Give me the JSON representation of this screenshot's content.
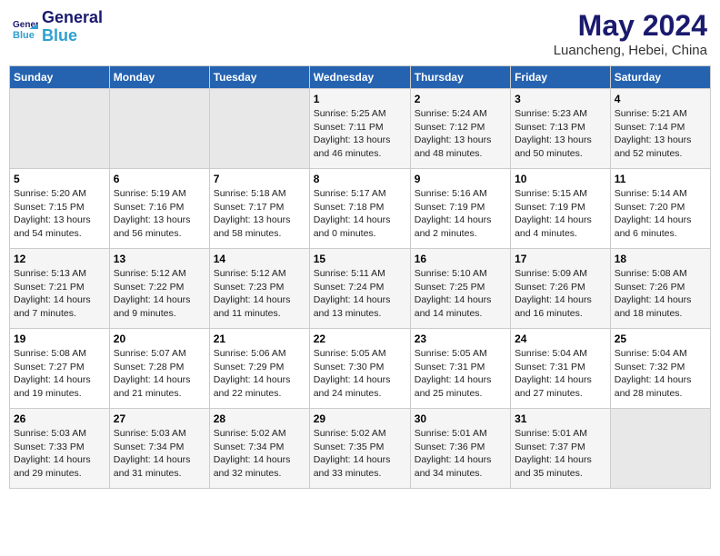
{
  "header": {
    "logo_line1": "General",
    "logo_line2": "Blue",
    "month_year": "May 2024",
    "location": "Luancheng, Hebei, China"
  },
  "weekdays": [
    "Sunday",
    "Monday",
    "Tuesday",
    "Wednesday",
    "Thursday",
    "Friday",
    "Saturday"
  ],
  "weeks": [
    [
      {
        "day": "",
        "info": ""
      },
      {
        "day": "",
        "info": ""
      },
      {
        "day": "",
        "info": ""
      },
      {
        "day": "1",
        "info": "Sunrise: 5:25 AM\nSunset: 7:11 PM\nDaylight: 13 hours\nand 46 minutes."
      },
      {
        "day": "2",
        "info": "Sunrise: 5:24 AM\nSunset: 7:12 PM\nDaylight: 13 hours\nand 48 minutes."
      },
      {
        "day": "3",
        "info": "Sunrise: 5:23 AM\nSunset: 7:13 PM\nDaylight: 13 hours\nand 50 minutes."
      },
      {
        "day": "4",
        "info": "Sunrise: 5:21 AM\nSunset: 7:14 PM\nDaylight: 13 hours\nand 52 minutes."
      }
    ],
    [
      {
        "day": "5",
        "info": "Sunrise: 5:20 AM\nSunset: 7:15 PM\nDaylight: 13 hours\nand 54 minutes."
      },
      {
        "day": "6",
        "info": "Sunrise: 5:19 AM\nSunset: 7:16 PM\nDaylight: 13 hours\nand 56 minutes."
      },
      {
        "day": "7",
        "info": "Sunrise: 5:18 AM\nSunset: 7:17 PM\nDaylight: 13 hours\nand 58 minutes."
      },
      {
        "day": "8",
        "info": "Sunrise: 5:17 AM\nSunset: 7:18 PM\nDaylight: 14 hours\nand 0 minutes."
      },
      {
        "day": "9",
        "info": "Sunrise: 5:16 AM\nSunset: 7:19 PM\nDaylight: 14 hours\nand 2 minutes."
      },
      {
        "day": "10",
        "info": "Sunrise: 5:15 AM\nSunset: 7:19 PM\nDaylight: 14 hours\nand 4 minutes."
      },
      {
        "day": "11",
        "info": "Sunrise: 5:14 AM\nSunset: 7:20 PM\nDaylight: 14 hours\nand 6 minutes."
      }
    ],
    [
      {
        "day": "12",
        "info": "Sunrise: 5:13 AM\nSunset: 7:21 PM\nDaylight: 14 hours\nand 7 minutes."
      },
      {
        "day": "13",
        "info": "Sunrise: 5:12 AM\nSunset: 7:22 PM\nDaylight: 14 hours\nand 9 minutes."
      },
      {
        "day": "14",
        "info": "Sunrise: 5:12 AM\nSunset: 7:23 PM\nDaylight: 14 hours\nand 11 minutes."
      },
      {
        "day": "15",
        "info": "Sunrise: 5:11 AM\nSunset: 7:24 PM\nDaylight: 14 hours\nand 13 minutes."
      },
      {
        "day": "16",
        "info": "Sunrise: 5:10 AM\nSunset: 7:25 PM\nDaylight: 14 hours\nand 14 minutes."
      },
      {
        "day": "17",
        "info": "Sunrise: 5:09 AM\nSunset: 7:26 PM\nDaylight: 14 hours\nand 16 minutes."
      },
      {
        "day": "18",
        "info": "Sunrise: 5:08 AM\nSunset: 7:26 PM\nDaylight: 14 hours\nand 18 minutes."
      }
    ],
    [
      {
        "day": "19",
        "info": "Sunrise: 5:08 AM\nSunset: 7:27 PM\nDaylight: 14 hours\nand 19 minutes."
      },
      {
        "day": "20",
        "info": "Sunrise: 5:07 AM\nSunset: 7:28 PM\nDaylight: 14 hours\nand 21 minutes."
      },
      {
        "day": "21",
        "info": "Sunrise: 5:06 AM\nSunset: 7:29 PM\nDaylight: 14 hours\nand 22 minutes."
      },
      {
        "day": "22",
        "info": "Sunrise: 5:05 AM\nSunset: 7:30 PM\nDaylight: 14 hours\nand 24 minutes."
      },
      {
        "day": "23",
        "info": "Sunrise: 5:05 AM\nSunset: 7:31 PM\nDaylight: 14 hours\nand 25 minutes."
      },
      {
        "day": "24",
        "info": "Sunrise: 5:04 AM\nSunset: 7:31 PM\nDaylight: 14 hours\nand 27 minutes."
      },
      {
        "day": "25",
        "info": "Sunrise: 5:04 AM\nSunset: 7:32 PM\nDaylight: 14 hours\nand 28 minutes."
      }
    ],
    [
      {
        "day": "26",
        "info": "Sunrise: 5:03 AM\nSunset: 7:33 PM\nDaylight: 14 hours\nand 29 minutes."
      },
      {
        "day": "27",
        "info": "Sunrise: 5:03 AM\nSunset: 7:34 PM\nDaylight: 14 hours\nand 31 minutes."
      },
      {
        "day": "28",
        "info": "Sunrise: 5:02 AM\nSunset: 7:34 PM\nDaylight: 14 hours\nand 32 minutes."
      },
      {
        "day": "29",
        "info": "Sunrise: 5:02 AM\nSunset: 7:35 PM\nDaylight: 14 hours\nand 33 minutes."
      },
      {
        "day": "30",
        "info": "Sunrise: 5:01 AM\nSunset: 7:36 PM\nDaylight: 14 hours\nand 34 minutes."
      },
      {
        "day": "31",
        "info": "Sunrise: 5:01 AM\nSunset: 7:37 PM\nDaylight: 14 hours\nand 35 minutes."
      },
      {
        "day": "",
        "info": ""
      }
    ]
  ]
}
